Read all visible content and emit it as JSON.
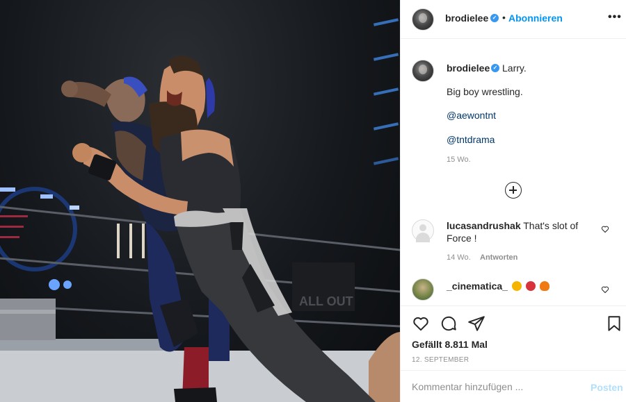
{
  "post": {
    "author": "brodielee",
    "follow_label": "Abonnieren",
    "dot": "•",
    "more_label": "•••"
  },
  "caption": {
    "username": "brodielee",
    "first_line": "Larry.",
    "line2": "Big boy wrestling.",
    "mention1": "@aewontnt",
    "mention2": "@tntdrama",
    "age": "15 Wo."
  },
  "comments": [
    {
      "username": "lucasandrushak",
      "text": "That's slot of Force !",
      "age": "14 Wo.",
      "reply_label": "Antworten"
    },
    {
      "username": "_cinematica_",
      "text": ""
    }
  ],
  "actions": {
    "likes": "Gefällt 8.811 Mal",
    "date": "12. SEPTEMBER"
  },
  "add_comment": {
    "placeholder": "Kommentar hinzufügen ...",
    "post_label": "Posten"
  },
  "icons": {
    "verified": "verified-badge-icon",
    "heart": "heart-icon",
    "comment": "comment-icon",
    "share": "paper-plane-icon",
    "save": "bookmark-icon",
    "load_more": "plus-circle-icon"
  },
  "colors": {
    "accent": "#0095f6",
    "verified": "#3897f0",
    "link": "#00376b",
    "muted": "#8e8e8e"
  }
}
